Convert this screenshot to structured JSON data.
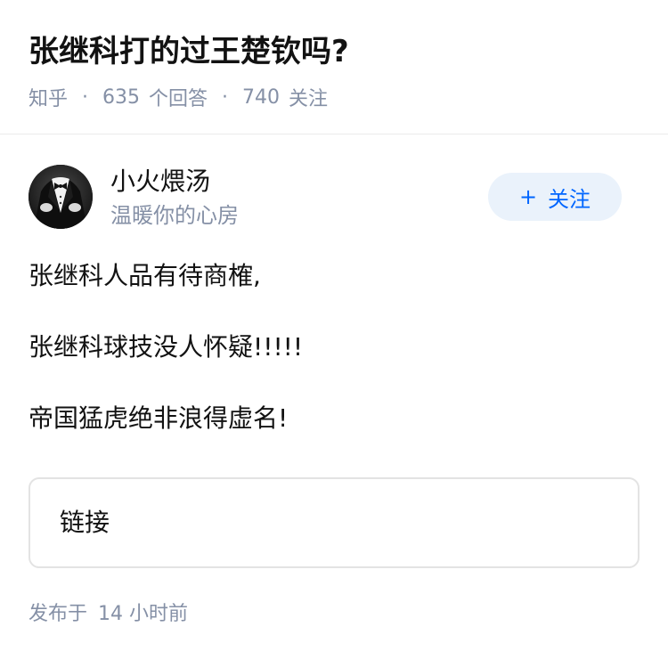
{
  "question": {
    "title": "张继科打的过王楚钦吗?",
    "source": "知乎",
    "answer_count": "635",
    "answer_label": "个回答",
    "follower_count": "740",
    "follower_label": "关注",
    "separator": "·"
  },
  "author": {
    "name": "小火煨汤",
    "bio": "温暖你的心房",
    "avatar_icon": "tuxedo-avatar-icon",
    "follow_button": {
      "plus": "+",
      "label": "关注"
    }
  },
  "answer": {
    "paragraphs": [
      "张继科人品有待商榷,",
      "张继科球技没人怀疑!!!!!",
      "帝国猛虎绝非浪得虚名!"
    ],
    "link_card_label": "链接"
  },
  "footer": {
    "publish_label": "发布于",
    "publish_time": "14 小时前"
  },
  "colors": {
    "meta_gray": "#8590a6",
    "accent_blue": "#0066ff",
    "follow_bg": "#eaf2fb",
    "text": "#121212"
  }
}
